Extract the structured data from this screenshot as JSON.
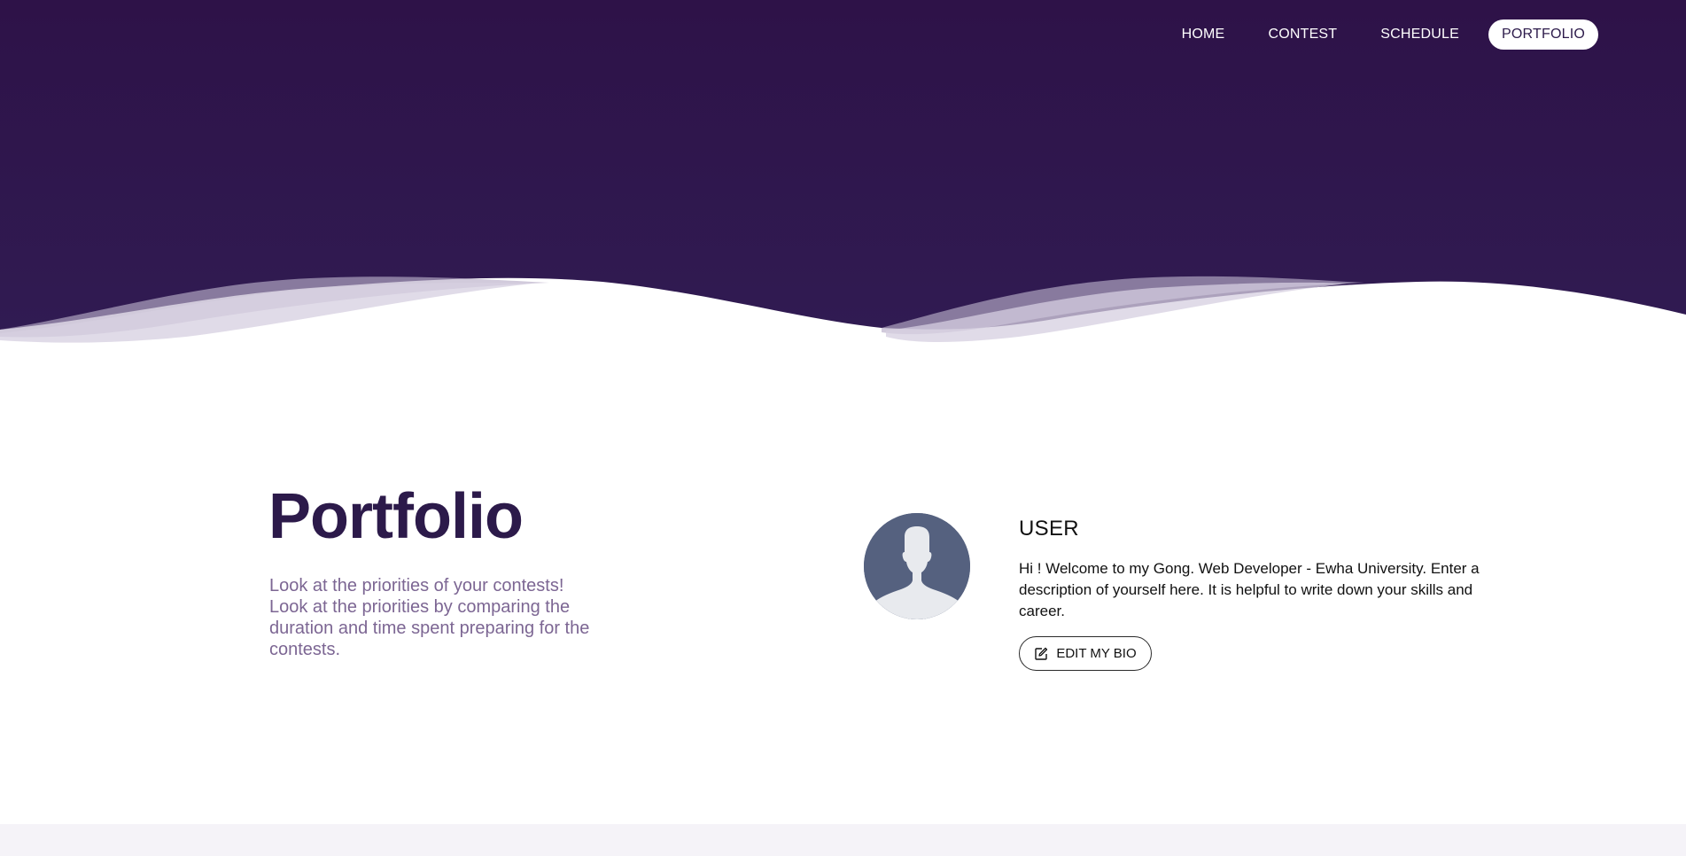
{
  "nav": {
    "items": [
      {
        "label": "HOME",
        "active": false
      },
      {
        "label": "CONTEST",
        "active": false
      },
      {
        "label": "SCHEDULE",
        "active": false
      },
      {
        "label": "PORTFOLIO",
        "active": true
      }
    ]
  },
  "hero": {
    "title": "Portfolio",
    "subtitle_lines": [
      "Look at the priorities of your contests!",
      "Look at the priorities by comparing the duration and time spent preparing for the contests."
    ]
  },
  "profile": {
    "name": "USER",
    "bio": "Hi ! Welcome to my Gong. Web Developer - Ewha University. Enter a description of yourself here. It is helpful to write down your skills and career.",
    "edit_button_label": "EDIT MY BIO",
    "edit_icon": "edit-icon",
    "avatar_icon": "user-silhouette-icon"
  },
  "colors": {
    "hero_background": "#2e1749",
    "title": "#2c1a4a",
    "subtitle": "#7c6693",
    "avatar_bg": "#55617f",
    "avatar_figure": "#e8eaee",
    "footer_band": "#f5f3f8"
  }
}
